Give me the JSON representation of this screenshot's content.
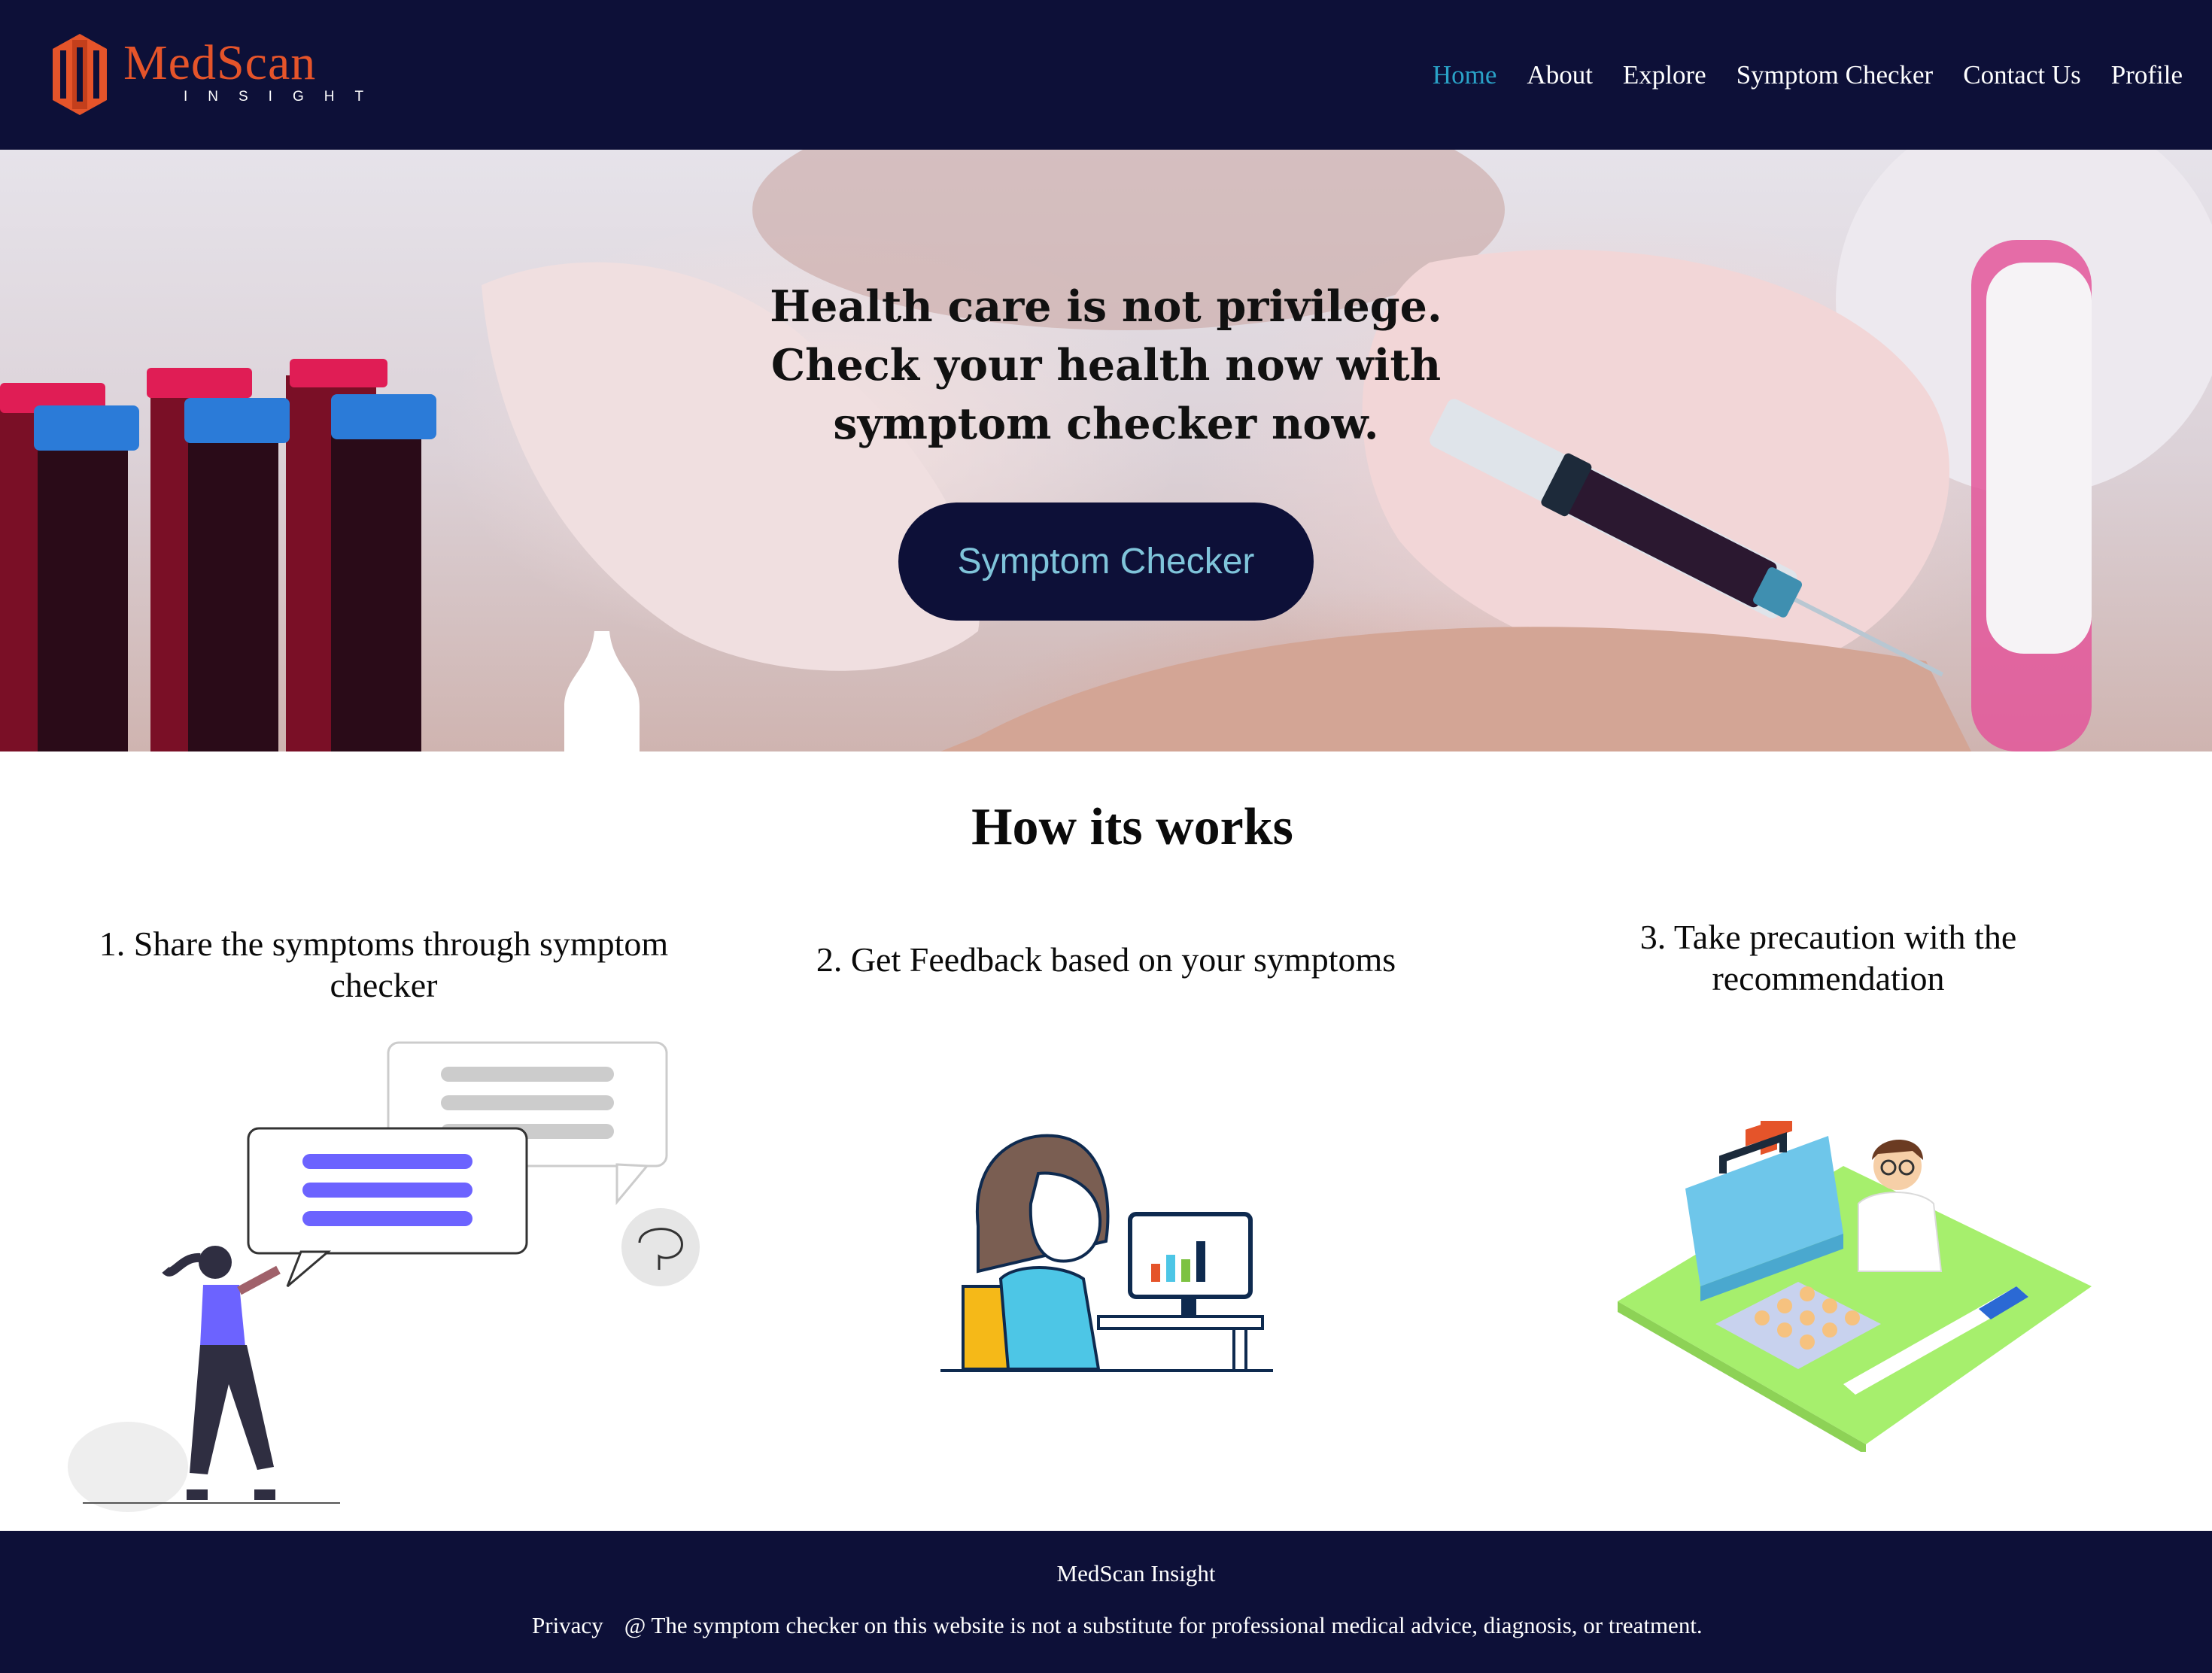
{
  "brand": {
    "name_main": "MedScan",
    "name_sub": "INSIGHT",
    "accent": "#e5542a"
  },
  "nav": {
    "items": [
      {
        "label": "Home",
        "active": true
      },
      {
        "label": "About"
      },
      {
        "label": "Explore"
      },
      {
        "label": "Symptom Checker"
      },
      {
        "label": "Contact Us"
      },
      {
        "label": "Profile"
      }
    ],
    "background": "#0d1038",
    "active_color": "#2aa3c8"
  },
  "hero": {
    "line1": "Health care is not privilege.",
    "line2": "Check your health now with",
    "line3": "symptom checker now.",
    "button_label": "Symptom Checker"
  },
  "how": {
    "title": "How its works",
    "steps": [
      {
        "line1": "1. Share the symptoms through symptom",
        "line2": "checker"
      },
      {
        "line1": "2. Get Feedback based on your symptoms"
      },
      {
        "line1": "3. Take precaution with the",
        "line2": "recommendation"
      }
    ]
  },
  "footer": {
    "brand": "MedScan Insight",
    "privacy_label": "Privacy",
    "disclaimer": "@ The symptom checker on this website is not a substitute for professional medical advice, diagnosis, or treatment."
  }
}
